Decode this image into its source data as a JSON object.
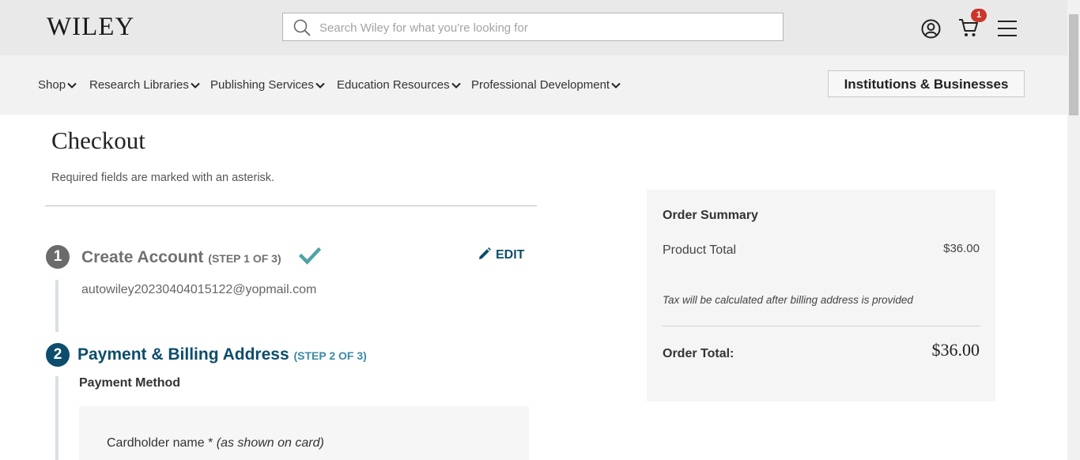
{
  "header": {
    "logo_text": "WILEY",
    "search_placeholder": "Search Wiley for what you're looking for",
    "cart_count": "1",
    "icons": [
      "search-icon",
      "account-icon",
      "cart-icon",
      "menu-icon"
    ]
  },
  "nav": {
    "items": [
      {
        "label": "Shop"
      },
      {
        "label": "Research Libraries"
      },
      {
        "label": "Publishing Services"
      },
      {
        "label": "Education Resources"
      },
      {
        "label": "Professional Development"
      }
    ],
    "institutions_button": "Institutions & Businesses"
  },
  "checkout": {
    "title": "Checkout",
    "required_note": "Required fields are marked with an asterisk.",
    "step1": {
      "number": "1",
      "title": "Create Account",
      "suffix": "(STEP 1 OF 3)",
      "edit_label": "EDIT",
      "email": "autowiley20230404015122@yopmail.com"
    },
    "step2": {
      "number": "2",
      "title": "Payment & Billing Address",
      "suffix": "(STEP 2 OF 3)",
      "payment_method_label": "Payment Method",
      "cardholder_label": "Cardholder name *",
      "cardholder_hint": "(as shown on card)"
    }
  },
  "order_summary": {
    "title": "Order Summary",
    "product_total_label": "Product Total",
    "product_total_value": "$36.00",
    "tax_note": "Tax will be calculated after billing address is provided",
    "order_total_label": "Order Total:",
    "order_total_value": "$36.00"
  },
  "colors": {
    "accent": "#0d4d6b",
    "check": "#4fa3a5",
    "badge": "#c9362b"
  }
}
